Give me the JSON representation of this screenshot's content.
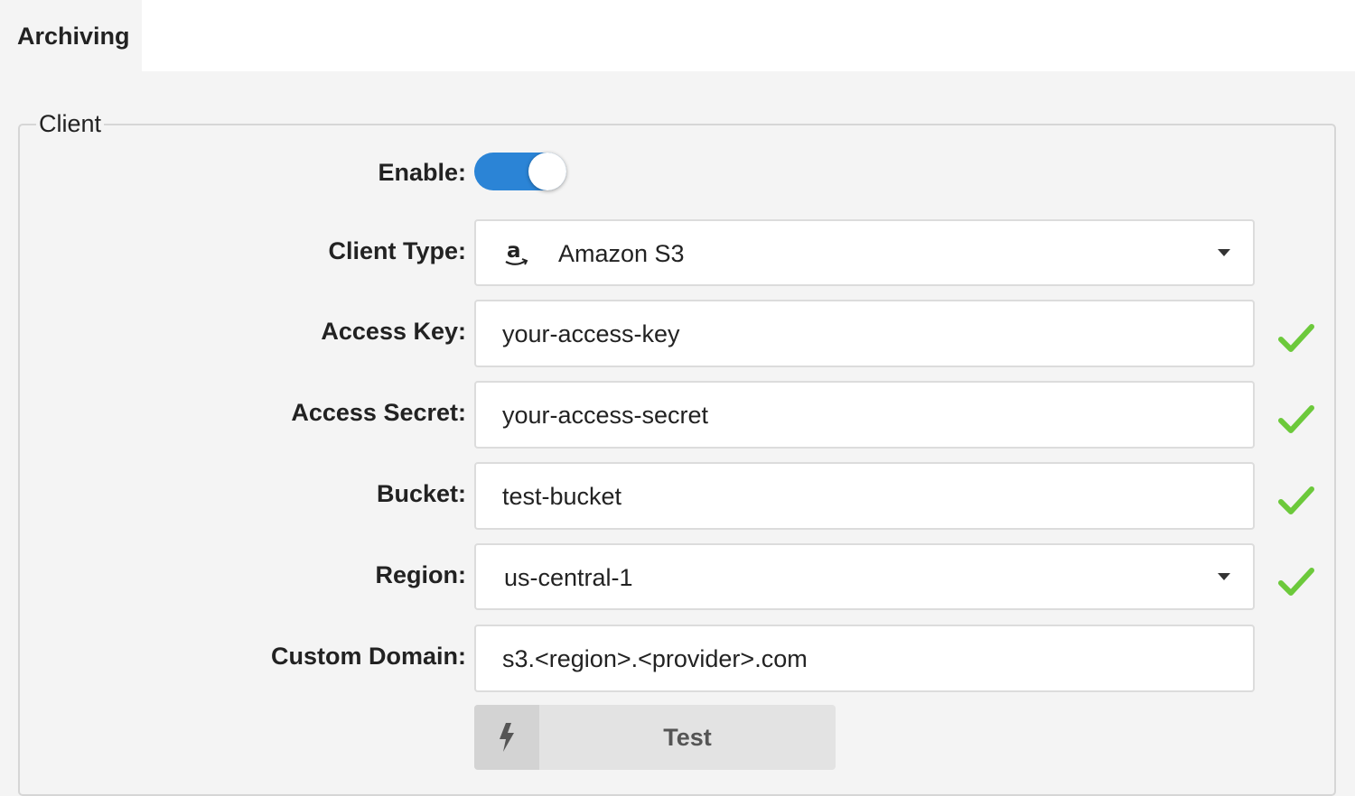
{
  "tabs": [
    {
      "label": "Archiving",
      "active": true
    }
  ],
  "section": {
    "legend": "Client"
  },
  "form": {
    "enable": {
      "label": "Enable:",
      "on": true
    },
    "client_type": {
      "label": "Client Type:",
      "value": "Amazon S3",
      "icon": "amazon-icon"
    },
    "access_key": {
      "label": "Access Key:",
      "value": "your-access-key",
      "valid": true
    },
    "access_secret": {
      "label": "Access Secret:",
      "value": "your-access-secret",
      "valid": true
    },
    "bucket": {
      "label": "Bucket:",
      "value": "test-bucket",
      "valid": true
    },
    "region": {
      "label": "Region:",
      "value": "us-central-1",
      "valid": true
    },
    "custom_domain": {
      "label": "Custom Domain:",
      "value": "s3.<region>.<provider>.com"
    }
  },
  "actions": {
    "test_label": "Test",
    "test_icon": "lightning-icon"
  },
  "colors": {
    "accent": "#2b84d6",
    "valid_check": "#6cc93b",
    "background": "#f4f4f4"
  }
}
